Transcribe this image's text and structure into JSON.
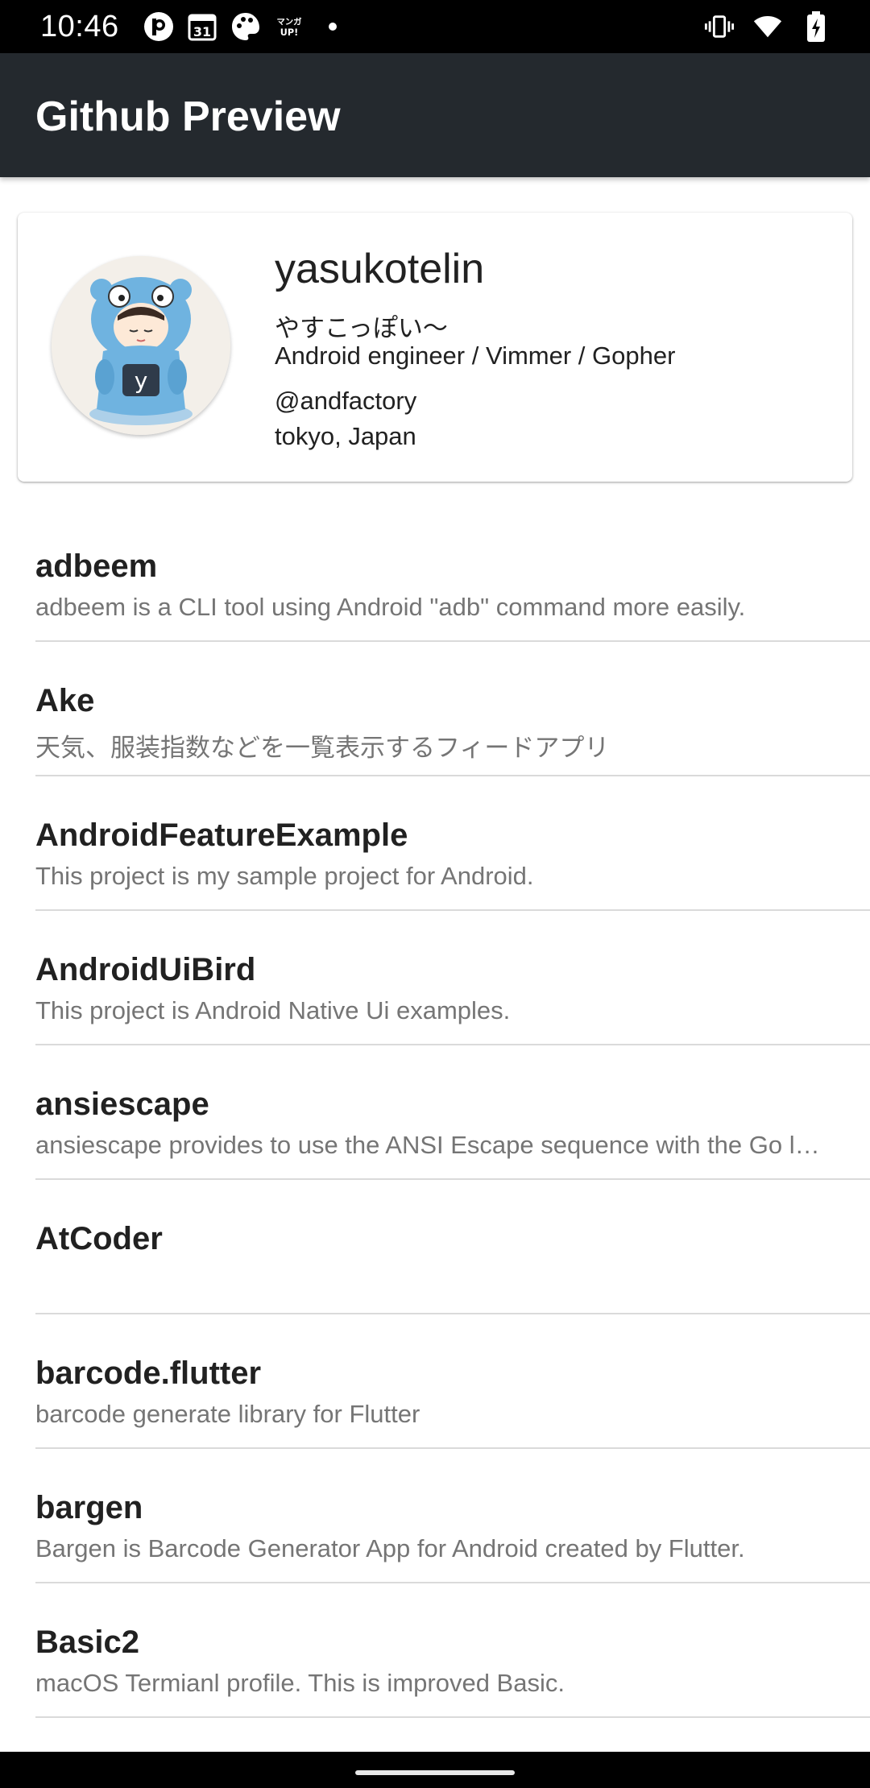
{
  "status_bar": {
    "time": "10:46",
    "notification_icons": [
      "pixiv-icon",
      "calendar-icon",
      "palette-icon",
      "manga-up-icon",
      "more-notifications-dot-icon"
    ],
    "calendar_day": "31",
    "manga_text": "マンガUP!",
    "system_icons": [
      "vibrate-icon",
      "wifi-icon",
      "battery-charging-icon"
    ]
  },
  "app_bar": {
    "title": "Github Preview"
  },
  "profile": {
    "login": "yasukotelin",
    "name": "やすこっぽい〜",
    "bio": "Android engineer / Vimmer / Gopher",
    "company": "@andfactory",
    "location": "tokyo, Japan"
  },
  "repositories": [
    {
      "name": "adbeem",
      "description": "adbeem is a CLI tool using Android \"adb\" command more easily."
    },
    {
      "name": "Ake",
      "description": "天気、服装指数などを一覧表示するフィードアプリ"
    },
    {
      "name": "AndroidFeatureExample",
      "description": "This project is my sample project for Android."
    },
    {
      "name": "AndroidUiBird",
      "description": "This project is Android Native Ui examples."
    },
    {
      "name": "ansiescape",
      "description": "ansiescape provides to use the ANSI Escape sequence with the Go language."
    },
    {
      "name": "AtCoder",
      "description": ""
    },
    {
      "name": "barcode.flutter",
      "description": "barcode generate library for Flutter"
    },
    {
      "name": "bargen",
      "description": "Bargen is Barcode Generator App for Android created by Flutter."
    },
    {
      "name": "Basic2",
      "description": "macOS Termianl profile. This is improved Basic."
    }
  ],
  "colors": {
    "app_bar": "#24292e",
    "status_bar": "#000000",
    "divider": "#dadada",
    "secondary_text": "#757575"
  }
}
